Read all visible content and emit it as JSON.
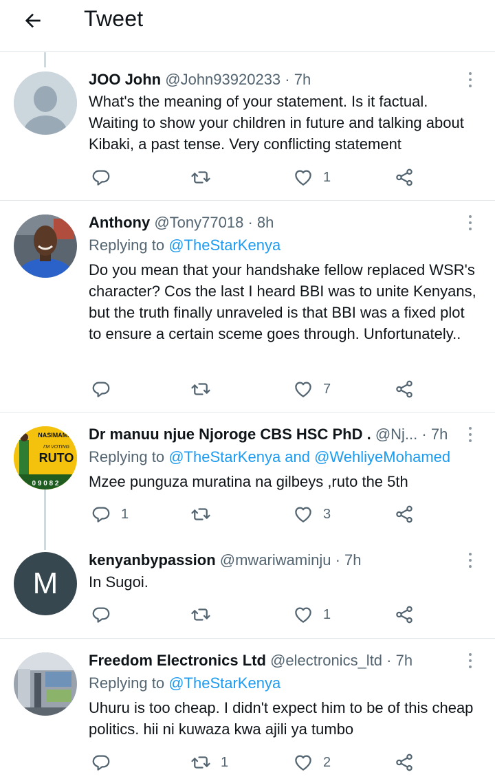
{
  "header": {
    "title": "Tweet"
  },
  "tweets": [
    {
      "name": "JOO John",
      "handle": "@John93920233",
      "time": "· 7h",
      "reply_prefix": "",
      "reply_mentions": "",
      "text": "What's the meaning of your statement. Is it factual. Waiting  to show your children in future and talking about Kibaki, a past tense. Very conflicting statement",
      "replies": "",
      "retweets": "",
      "likes": "1",
      "avatar": "default-avatar-icon"
    },
    {
      "name": "Anthony",
      "handle": "@Tony77018",
      "time": "· 8h",
      "reply_prefix": "Replying to",
      "reply_mentions": "@TheStarKenya",
      "text": "Do you mean that your handshake fellow replaced WSR's character? Cos the last I heard BBI was to unite Kenyans, but the truth finally unraveled is that BBI was a fixed plot to ensure a certain sceme goes through. Unfortunately..",
      "replies": "",
      "retweets": "",
      "likes": "7",
      "avatar": "photo-avatar"
    },
    {
      "name": "Dr manuu njue Njoroge CBS HSC PhD .",
      "handle": "@Nj...",
      "time": "· 7h",
      "reply_prefix": "Replying to",
      "reply_mentions": "@TheStarKenya and @WehliyeMohamed",
      "text": "Mzee punguza muratina na gilbeys ,ruto the 5th",
      "replies": "1",
      "retweets": "",
      "likes": "3",
      "avatar": "poster-avatar",
      "avatar_text": [
        "NASIMAMA",
        "I'M VOTING",
        "RUTO",
        "0 9 0 8 2"
      ]
    },
    {
      "name": "kenyanbypassion",
      "handle": "@mwariwaminju",
      "time": "· 7h",
      "reply_prefix": "",
      "reply_mentions": "",
      "text": "In Sugoi.",
      "replies": "",
      "retweets": "",
      "likes": "1",
      "avatar": "letter-avatar",
      "avatar_letter": "M"
    },
    {
      "name": "Freedom Electronics Ltd",
      "handle": "@electronics_ltd",
      "time": "· 7h",
      "reply_prefix": "Replying to",
      "reply_mentions": "@TheStarKenya",
      "text": "Uhuru is too cheap.  I didn't expect him to be of this cheap politics. hii ni kuwaza kwa ajili ya tumbo",
      "replies": "",
      "retweets": "1",
      "likes": "2",
      "avatar": "shop-avatar"
    }
  ],
  "colors": {
    "name": "#0f1419",
    "secondary": "#536471",
    "mention": "#1d9bf0",
    "divider": "#e1e6ea",
    "thread_line": "#cfd9de",
    "letter_avatar_bg": "#37474f"
  }
}
